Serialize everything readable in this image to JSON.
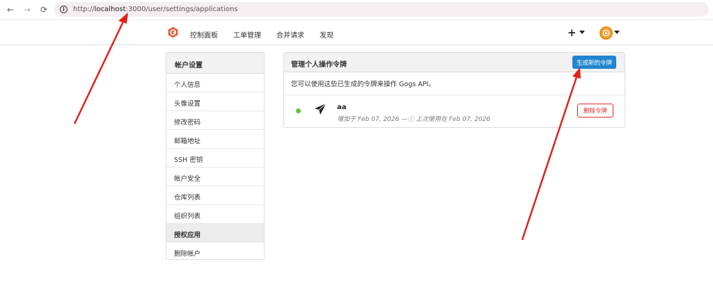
{
  "browser": {
    "back": "←",
    "forward": "→",
    "reload": "⟳",
    "url_prefix": "http://",
    "url_host": "localhost",
    "url_rest": ":3000/user/settings/applications"
  },
  "header": {
    "nav": [
      "控制面板",
      "工单管理",
      "合并请求",
      "发现"
    ],
    "plus": "+"
  },
  "sidebar": {
    "title": "帐户设置",
    "items": [
      {
        "label": "个人信息"
      },
      {
        "label": "头像设置"
      },
      {
        "label": "修改密码"
      },
      {
        "label": "邮箱地址"
      },
      {
        "label": "SSH 密钥"
      },
      {
        "label": "帐户安全"
      },
      {
        "label": "仓库列表"
      },
      {
        "label": "组织列表"
      },
      {
        "label": "授权应用",
        "active": true
      },
      {
        "label": "删除帐户"
      }
    ]
  },
  "main": {
    "title": "管理个人操作令牌",
    "generate_button": "生成新的令牌",
    "description": "您可以使用这些已生成的令牌来操作 Gogs API。",
    "token": {
      "name": "aa",
      "meta": "增加于 Feb 07, 2026 —ⓘ 上次使用在 Feb 07, 2026",
      "delete_button": "删除令牌"
    }
  },
  "colors": {
    "primary": "#2185d0",
    "danger": "#db2828",
    "status_green": "#5fc43a",
    "annotation_arrow": "#e0211b"
  },
  "icons": {
    "logo": "gogs-logo-icon",
    "token": "send-icon",
    "info": "info-icon"
  }
}
